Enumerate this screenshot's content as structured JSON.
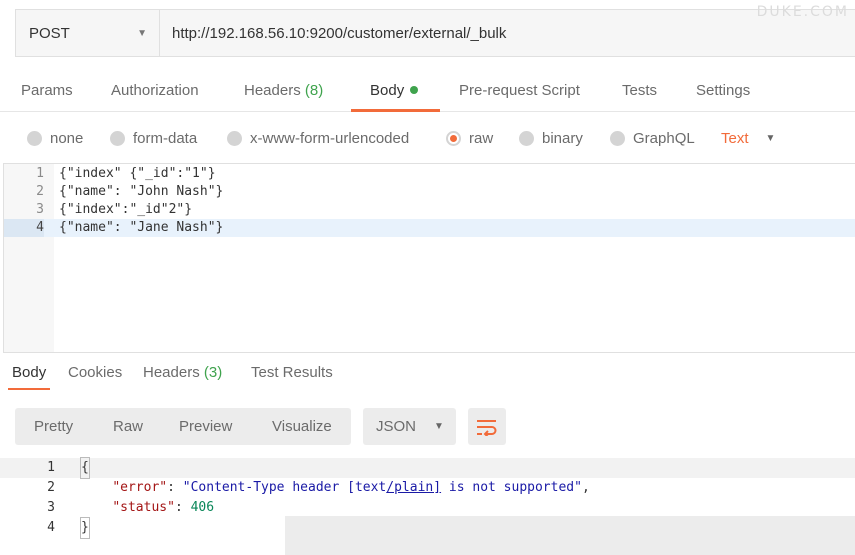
{
  "request": {
    "method": "POST",
    "url": "http://192.168.56.10:9200/customer/external/_bulk",
    "watermark": "DUKE.COM"
  },
  "request_tabs": [
    {
      "label": "Params"
    },
    {
      "label": "Authorization"
    },
    {
      "label": "Headers",
      "count": "(8)"
    },
    {
      "label": "Body",
      "active": true
    },
    {
      "label": "Pre-request Script"
    },
    {
      "label": "Tests"
    },
    {
      "label": "Settings"
    }
  ],
  "body_types": {
    "options": [
      "none",
      "form-data",
      "x-www-form-urlencoded",
      "raw",
      "binary",
      "GraphQL"
    ],
    "selected": "raw",
    "format": "Text"
  },
  "request_body": {
    "lines": [
      {
        "num": "1",
        "text": "{\"index\" {\"_id\":\"1\"}"
      },
      {
        "num": "2",
        "text": "{\"name\": \"John Nash\"}"
      },
      {
        "num": "3",
        "text": "{\"index\":\"_id\"2\"}"
      },
      {
        "num": "4",
        "text": "{\"name\": \"Jane Nash\"}"
      }
    ],
    "current_line": 4
  },
  "response_tabs": [
    {
      "label": "Body",
      "active": true
    },
    {
      "label": "Cookies"
    },
    {
      "label": "Headers",
      "count": "(3)"
    },
    {
      "label": "Test Results"
    }
  ],
  "response_view": {
    "modes": [
      "Pretty",
      "Raw",
      "Preview",
      "Visualize"
    ],
    "format": "JSON"
  },
  "response_body": {
    "line_numbers": [
      "1",
      "2",
      "3",
      "4"
    ],
    "open_brace": "{",
    "error_key": "\"error\"",
    "error_value_part1": "\"Content-Type header [text",
    "error_value_part2": "/plain]",
    "error_value_part3": " is not supported\"",
    "status_key": "\"status\"",
    "status_value": "406",
    "close_brace": "}",
    "colors": {
      "key": "#a31515",
      "string": "#1a1aa6",
      "number": "#098658"
    }
  },
  "colors": {
    "accent": "#f26b3a",
    "count_green": "#3fa34d"
  }
}
